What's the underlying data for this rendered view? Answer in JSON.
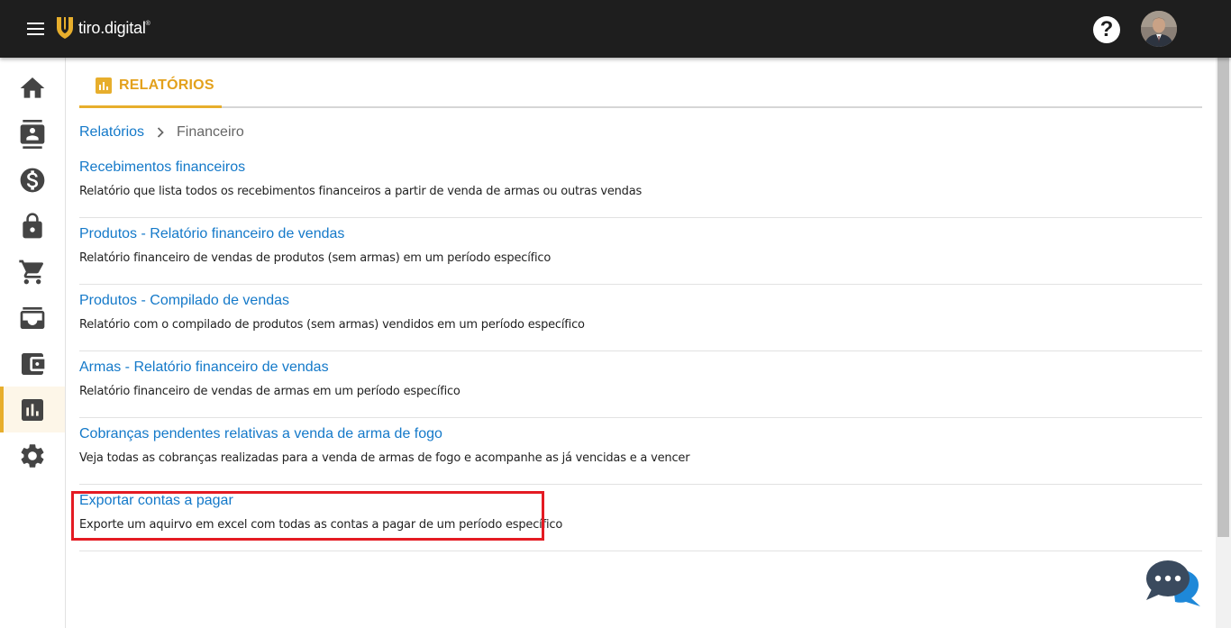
{
  "header": {
    "logo_text": "tiro.digital",
    "logo_mark": "®",
    "help_label": "?"
  },
  "sidebar": {
    "items": [
      {
        "name": "home",
        "icon": "home-icon"
      },
      {
        "name": "contacts",
        "icon": "contact-card-icon"
      },
      {
        "name": "finance",
        "icon": "dollar-icon"
      },
      {
        "name": "security",
        "icon": "lock-icon"
      },
      {
        "name": "sales",
        "icon": "cart-icon"
      },
      {
        "name": "inbox",
        "icon": "inbox-icon"
      },
      {
        "name": "wallet",
        "icon": "wallet-icon"
      },
      {
        "name": "reports",
        "icon": "bar-chart-icon",
        "active": true
      },
      {
        "name": "settings",
        "icon": "gear-icon"
      }
    ],
    "accent_color": "#e7ae2c"
  },
  "tab": {
    "label": "RELATÓRIOS",
    "color": "#e3a11c"
  },
  "breadcrumb": {
    "root": "Relatórios",
    "separator": "›",
    "current": "Financeiro"
  },
  "reports": [
    {
      "title": "Recebimentos financeiros",
      "description": "Relatório que lista todos os recebimentos financeiros a partir de venda de armas ou outras vendas"
    },
    {
      "title": "Produtos - Relatório financeiro de vendas",
      "description": "Relatório financeiro de vendas de produtos (sem armas) em um período específico"
    },
    {
      "title": "Produtos - Compilado de vendas",
      "description": "Relatório com o compilado de produtos (sem armas) vendidos em um período específico"
    },
    {
      "title": "Armas - Relatório financeiro de vendas",
      "description": "Relatório financeiro de vendas de armas em um período específico"
    },
    {
      "title": "Cobranças pendentes relativas a venda de arma de fogo",
      "description": "Veja todas as cobranças realizadas para a venda de armas de fogo e acompanhe as já vencidas e a vencer"
    },
    {
      "title": "Exportar contas a pagar",
      "description": "Exporte um aquirvo em excel com todas as contas a pagar de um período específico"
    }
  ],
  "colors": {
    "link": "#1479c9",
    "highlight_border": "#e41b23",
    "topbar": "#1e1e1e"
  }
}
